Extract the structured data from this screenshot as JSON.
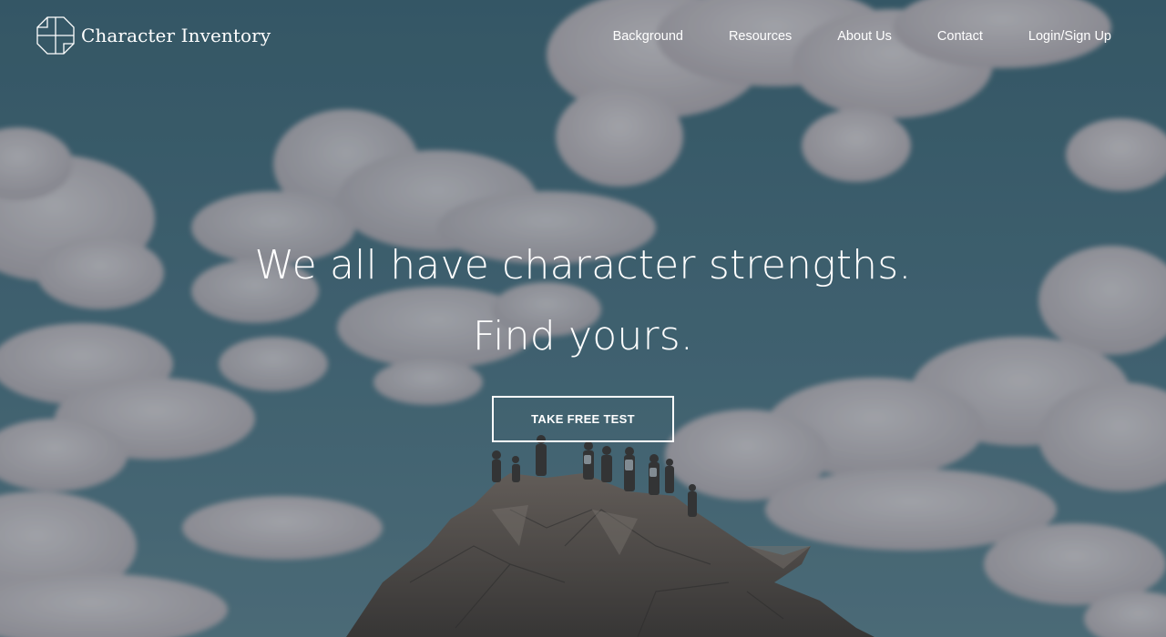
{
  "brand": {
    "name": "Character Inventory",
    "logo_icon": "octagon-cross-logo-icon"
  },
  "nav": {
    "items": [
      {
        "label": "Background"
      },
      {
        "label": "Resources"
      },
      {
        "label": "About Us"
      },
      {
        "label": "Contact"
      },
      {
        "label": "Login/Sign Up"
      }
    ]
  },
  "hero": {
    "headline_line1": "We all have character strengths.",
    "headline_line2": "Find yours.",
    "cta_label": "TAKE FREE TEST",
    "background": "sky-clouds-mountain-summit-photo"
  },
  "colors": {
    "sky_overlay": "#3f6472",
    "cloud": "#d8cfd2",
    "rock": "#5e5048",
    "text": "#ffffff"
  }
}
